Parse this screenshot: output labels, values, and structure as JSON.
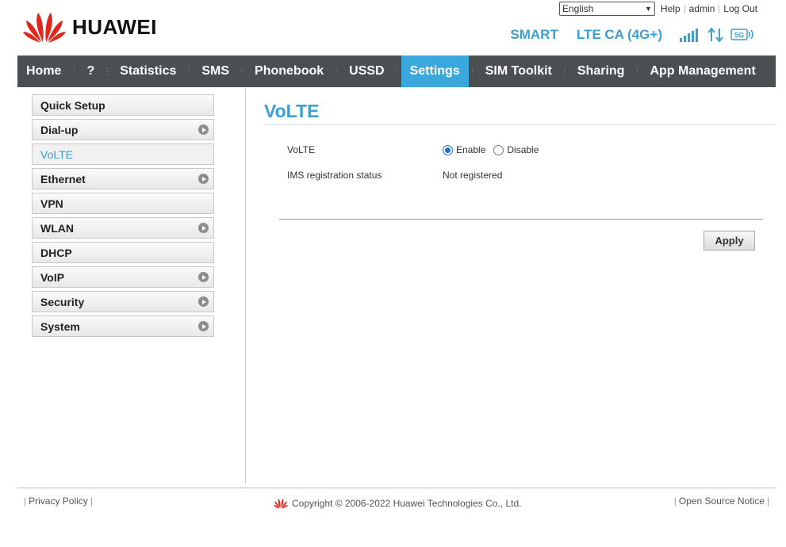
{
  "header": {
    "brand": "HUAWEI",
    "language": "English",
    "help": "Help",
    "user": "admin",
    "logout": "Log Out",
    "operator": "SMART",
    "network": "LTE CA (4G+)",
    "badge_5g": "5G"
  },
  "nav": {
    "items": [
      "Home",
      "?",
      "Statistics",
      "SMS",
      "Phonebook",
      "USSD",
      "Settings",
      "SIM Toolkit",
      "Sharing",
      "App Management"
    ],
    "active": "Settings"
  },
  "sidebar": {
    "items": [
      {
        "label": "Quick Setup"
      },
      {
        "label": "Dial-up"
      },
      {
        "label": "VoLTE"
      },
      {
        "label": "Ethernet"
      },
      {
        "label": "VPN"
      },
      {
        "label": "WLAN"
      },
      {
        "label": "DHCP"
      },
      {
        "label": "VoIP"
      },
      {
        "label": "Security"
      },
      {
        "label": "System"
      }
    ]
  },
  "content": {
    "title": "VoLTE",
    "volte_label": "VoLTE",
    "enable_label": "Enable",
    "disable_label": "Disable",
    "ims_label": "IMS registration status",
    "ims_value": "Not registered",
    "apply": "Apply"
  },
  "footer": {
    "privacy": "Privacy Policy",
    "copyright": "Copyright © 2006-2022 Huawei Technologies Co., Ltd.",
    "open_source": "Open Source Notice"
  },
  "colors": {
    "accent": "#3aa0d3",
    "nav_bg": "#4a4f52",
    "nav_active": "#3aa7dd",
    "brand_red": "#e0261d"
  }
}
